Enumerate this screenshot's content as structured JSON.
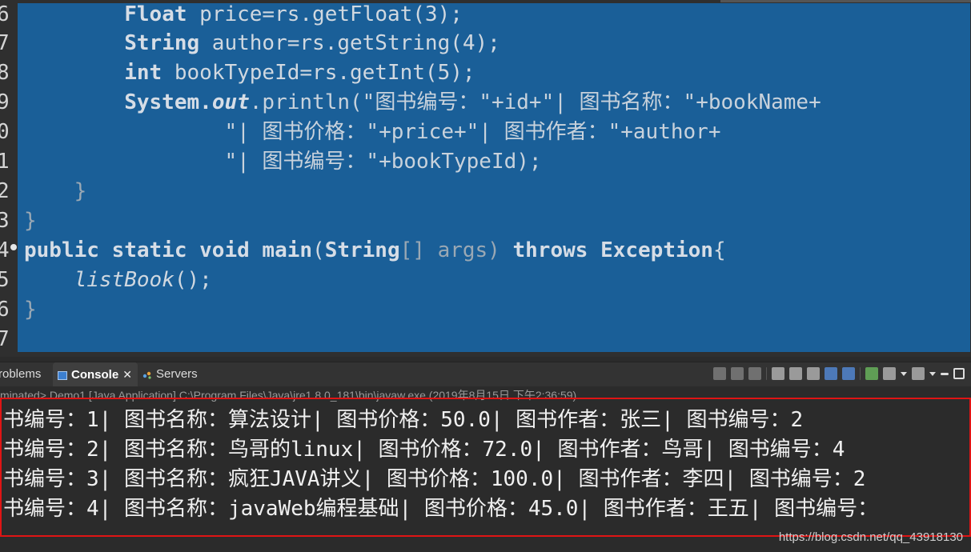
{
  "editor": {
    "gutter": [
      "6",
      "7",
      "8",
      "9",
      "0",
      "1",
      "2",
      "3",
      "4",
      "5",
      "6",
      "7"
    ],
    "lines": [
      {
        "indent": "        ",
        "kw": "Float",
        "rest": " price=rs.getFloat(3);"
      },
      {
        "indent": "        ",
        "kw": "String",
        "rest": " author=rs.getString(4);"
      },
      {
        "indent": "        ",
        "kw": "int",
        "rest": " bookTypeId=rs.getInt(5);"
      },
      {
        "text_a": "        System.",
        "text_out": "out",
        "text_b": ".println(\"图书编号：\"+id+\"| 图书名称：\"+bookName+"
      },
      {
        "text": "                \"| 图书价格：\"+price+\"| 图书作者：\"+author+"
      },
      {
        "text": "                \"| 图书编号：\"+bookTypeId);"
      },
      {
        "text": "    }"
      },
      {
        "text": "}"
      },
      {
        "main_kw": "public static void main",
        "main_rest": "(",
        "main_type": "String",
        "main_tail": "[] args) ",
        "main_throws": "throws Exception",
        "main_brace": "{"
      },
      {
        "call": "listBook",
        "call_tail": "();",
        "indent": "    "
      },
      {
        "text": "}"
      },
      {
        "text": ""
      }
    ]
  },
  "tabs": {
    "problems": "roblems",
    "console": "Console",
    "servers": "Servers"
  },
  "console": {
    "status": "minated> Demo1 [Java Application] C:\\Program Files\\Java\\jre1.8.0_181\\bin\\javaw.exe (2019年8月15日 下午2:36:59)",
    "output": [
      "书编号：1| 图书名称：算法设计| 图书价格：50.0| 图书作者：张三| 图书编号：2",
      "书编号：2| 图书名称：鸟哥的linux| 图书价格：72.0| 图书作者：鸟哥| 图书编号：4",
      "书编号：3| 图书名称：疯狂JAVA讲义| 图书价格：100.0| 图书作者：李四| 图书编号：2",
      "书编号：4| 图书名称：javaWeb编程基础| 图书价格：45.0| 图书作者：王五| 图书编号："
    ]
  },
  "watermark": "https://blog.csdn.net/qq_43918130"
}
